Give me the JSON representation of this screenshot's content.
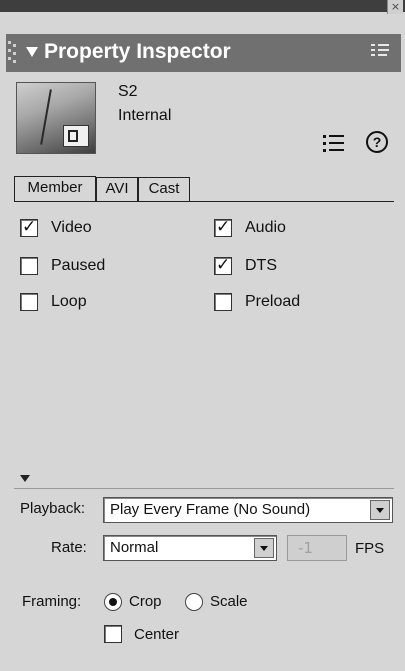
{
  "window": {
    "close_glyph": "×",
    "title": "Property Inspector"
  },
  "member": {
    "name": "S2",
    "type": "Internal"
  },
  "tabs": [
    {
      "label": "Member"
    },
    {
      "label": "AVI"
    },
    {
      "label": "Cast"
    }
  ],
  "options": {
    "video": {
      "label": "Video",
      "checked": true
    },
    "paused": {
      "label": "Paused",
      "checked": false
    },
    "loop": {
      "label": "Loop",
      "checked": false
    },
    "audio": {
      "label": "Audio",
      "checked": true
    },
    "dts": {
      "label": "DTS",
      "checked": true
    },
    "preload": {
      "label": "Preload",
      "checked": false
    }
  },
  "playback": {
    "label": "Playback:",
    "value": "Play Every Frame (No Sound)"
  },
  "rate": {
    "label": "Rate:",
    "value": "Normal",
    "fps_value": "-1",
    "fps_label": "FPS"
  },
  "framing": {
    "label": "Framing:",
    "options": [
      {
        "label": "Crop",
        "selected": true
      },
      {
        "label": "Scale",
        "selected": false
      }
    ],
    "center": {
      "label": "Center",
      "checked": false
    }
  },
  "icons": {
    "help_glyph": "?"
  }
}
